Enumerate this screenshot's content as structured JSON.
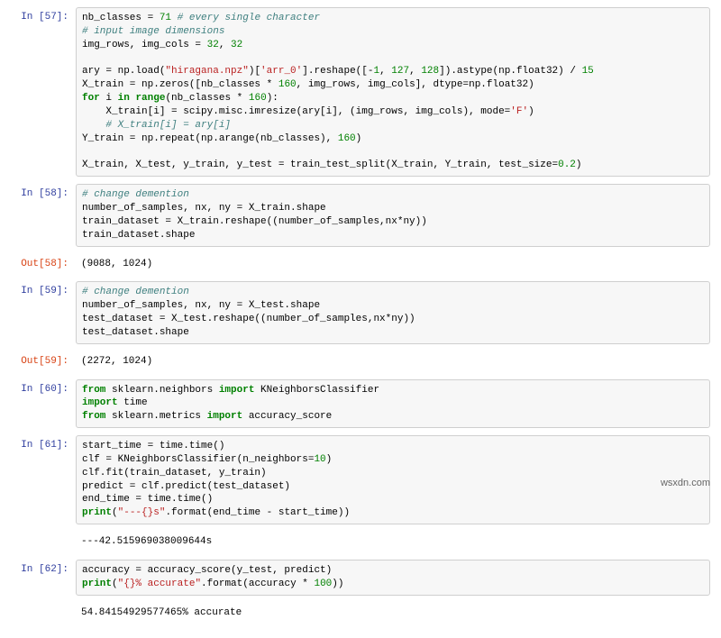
{
  "cells": [
    {
      "in_prompt": "In [57]:",
      "code_html": "nb_classes = <span class='tk-m'>71</span> <span class='tk-c'># every single character</span>\n<span class='tk-c'># input image dimensions</span>\nimg_rows, img_cols = <span class='tk-m'>32</span>, <span class='tk-m'>32</span>\n\nary = np.load(<span class='tk-s'>\"hiragana.npz\"</span>)[<span class='tk-s'>'arr_0'</span>].reshape([-<span class='tk-m'>1</span>, <span class='tk-m'>127</span>, <span class='tk-m'>128</span>]).astype(np.float32) / <span class='tk-m'>15</span>\nX_train = np.zeros([nb_classes * <span class='tk-m'>160</span>, img_rows, img_cols], dtype=np.float32)\n<span class='tk-k'>for</span> i <span class='tk-k'>in</span> <span class='tk-k'>range</span>(nb_classes * <span class='tk-m'>160</span>):\n    X_train[i] = scipy.misc.imresize(ary[i], (img_rows, img_cols), mode=<span class='tk-s'>'F'</span>)\n    <span class='tk-c'># X_train[i] = ary[i]</span>\nY_train = np.repeat(np.arange(nb_classes), <span class='tk-m'>160</span>)\n\nX_train, X_test, y_train, y_test = train_test_split(X_train, Y_train, test_size=<span class='tk-m'>0.2</span>)"
    },
    {
      "in_prompt": "In [58]:",
      "code_html": "<span class='tk-c'># change demention</span>\nnumber_of_samples, nx, ny = X_train.shape\ntrain_dataset = X_train.reshape((number_of_samples,nx*ny))\ntrain_dataset.shape",
      "out_prompt": "Out[58]:",
      "out_text": "(9088, 1024)"
    },
    {
      "in_prompt": "In [59]:",
      "code_html": "<span class='tk-c'># change demention</span>\nnumber_of_samples, nx, ny = X_test.shape\ntest_dataset = X_test.reshape((number_of_samples,nx*ny))\ntest_dataset.shape",
      "out_prompt": "Out[59]:",
      "out_text": "(2272, 1024)"
    },
    {
      "in_prompt": "In [60]:",
      "code_html": "<span class='tk-k'>from</span> sklearn.neighbors <span class='tk-k'>import</span> KNeighborsClassifier\n<span class='tk-k'>import</span> time\n<span class='tk-k'>from</span> sklearn.metrics <span class='tk-k'>import</span> accuracy_score"
    },
    {
      "in_prompt": "In [61]:",
      "code_html": "start_time = time.time()\nclf = KNeighborsClassifier(n_neighbors=<span class='tk-m'>10</span>)\nclf.fit(train_dataset, y_train)\npredict = clf.predict(test_dataset)\nend_time = time.time()\n<span class='tk-k'>print</span>(<span class='tk-s'>\"---{}s\"</span>.format(end_time - start_time))",
      "stdout_text": "---42.515969038009644s"
    },
    {
      "in_prompt": "In [62]:",
      "code_html": "accuracy = accuracy_score(y_test, predict)\n<span class='tk-k'>print</span>(<span class='tk-s'>\"{}% accurate\"</span>.format(accuracy * <span class='tk-m'>100</span>))",
      "stdout_text": "54.84154929577465% accurate"
    }
  ],
  "watermark": "wsxdn.com"
}
